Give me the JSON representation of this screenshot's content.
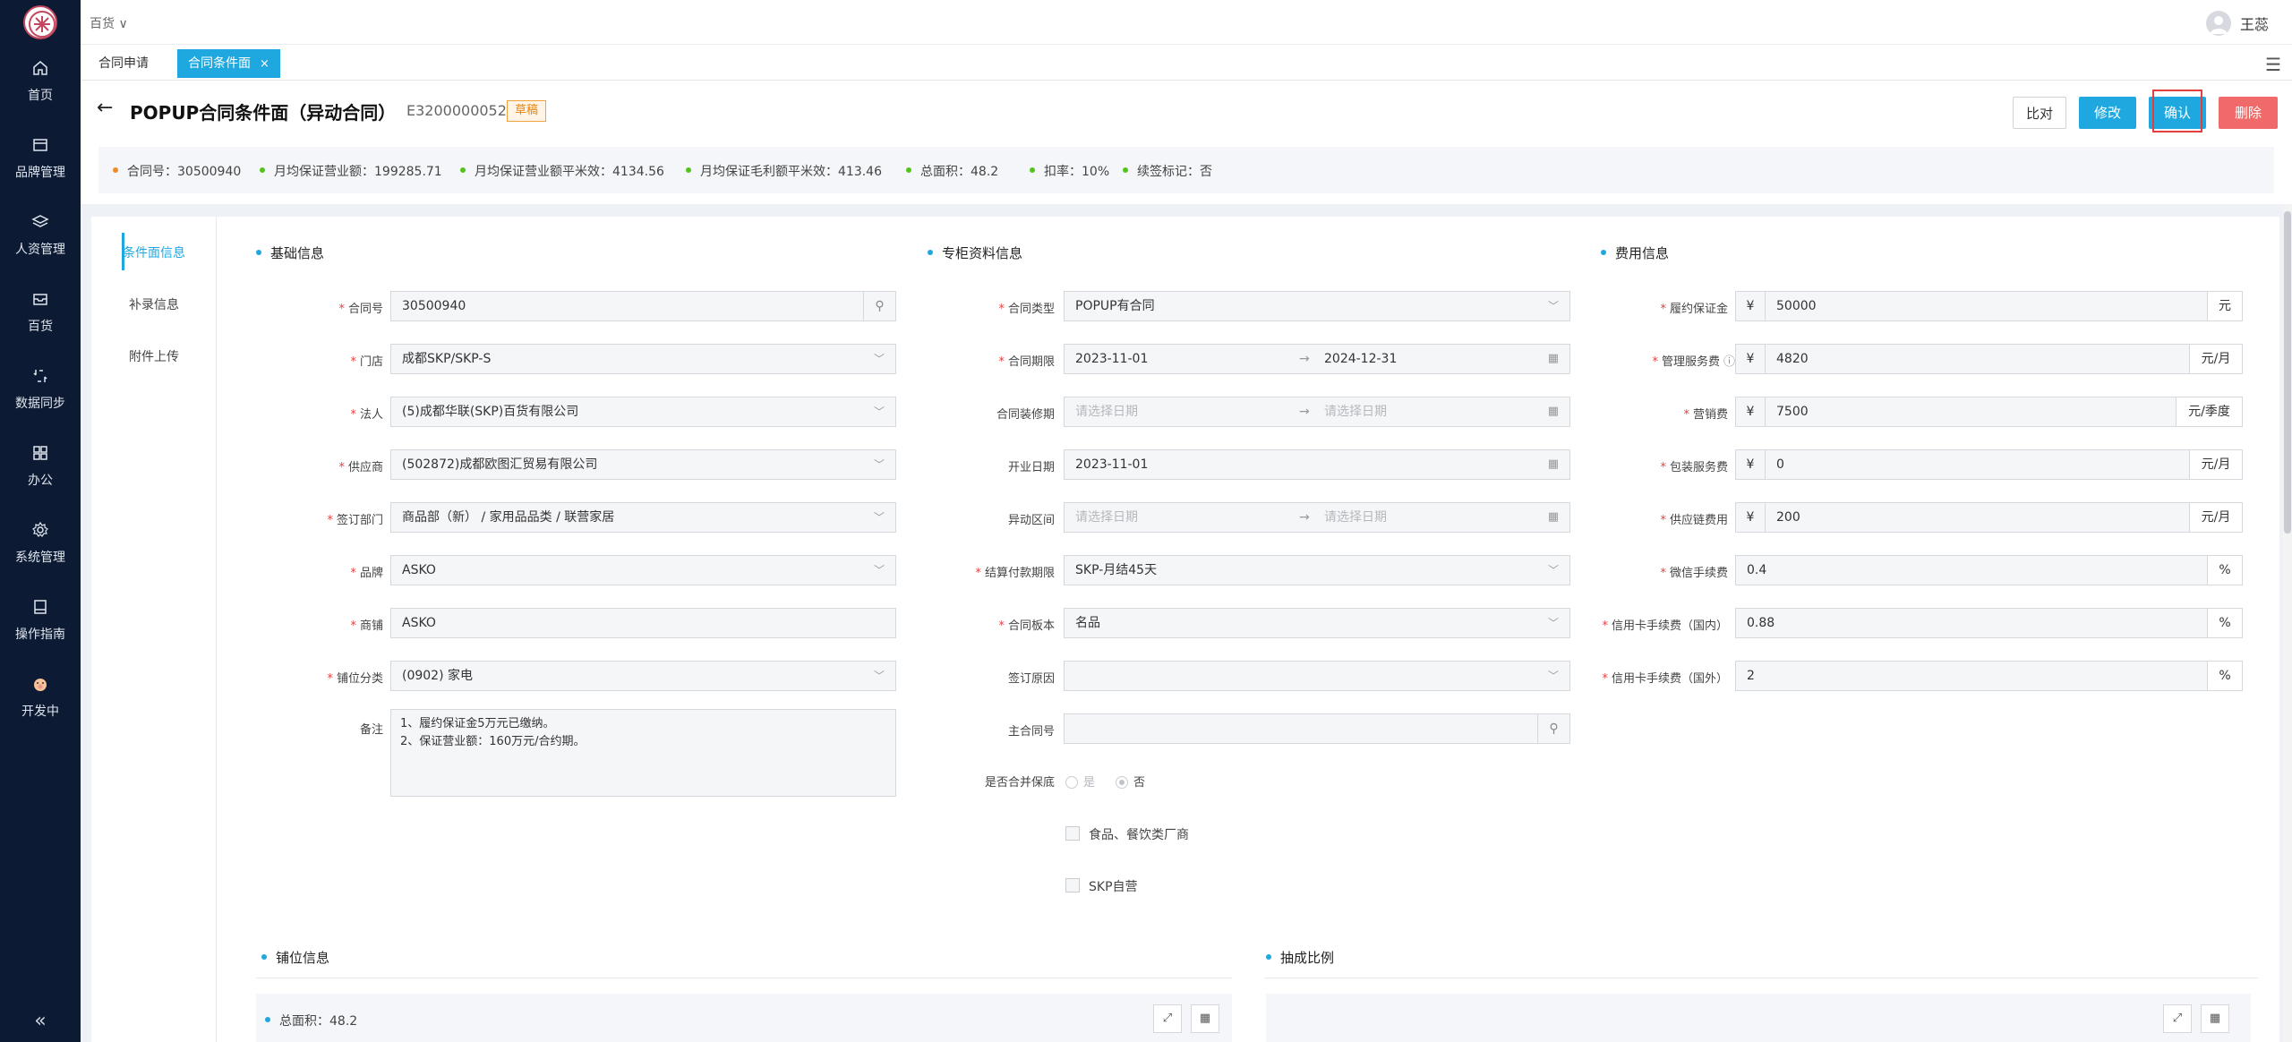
{
  "sidebar": {
    "items": [
      {
        "label": "首页",
        "icon": "home-icon"
      },
      {
        "label": "品牌管理",
        "icon": "brand-icon"
      },
      {
        "label": "人资管理",
        "icon": "layers-icon"
      },
      {
        "label": "百货",
        "icon": "inbox-icon"
      },
      {
        "label": "数据同步",
        "icon": "sync-icon"
      },
      {
        "label": "办公",
        "icon": "grid-icon"
      },
      {
        "label": "系统管理",
        "icon": "gear-icon"
      },
      {
        "label": "操作指南",
        "icon": "book-icon"
      },
      {
        "label": "开发中",
        "icon": "pig-icon"
      }
    ],
    "collapse": "«"
  },
  "topbar": {
    "store": "百货 ∨",
    "user": "王蕊"
  },
  "tabs": [
    {
      "label": "合同申请"
    },
    {
      "label": "合同条件面",
      "close": "×"
    }
  ],
  "header": {
    "back": "←",
    "title": "POPUP合同条件面（异动合同）",
    "code": "E3200000052",
    "status": "草稿",
    "buttons": {
      "compare": "比对",
      "edit": "修改",
      "confirm": "确认",
      "delete": "删除"
    }
  },
  "infobar": [
    {
      "text": "合同号：30500940",
      "color": "#f08a24"
    },
    {
      "text": "月均保证营业额：199285.71",
      "color": "#52c41a"
    },
    {
      "text": "月均保证营业额平米效：4134.56",
      "color": "#52c41a"
    },
    {
      "text": "月均保证毛利额平米效：413.46",
      "color": "#52c41a"
    },
    {
      "text": "总面积：48.2",
      "color": "#52c41a"
    },
    {
      "text": "扣率：10%",
      "color": "#52c41a"
    },
    {
      "text": "续签标记：否",
      "color": "#52c41a"
    }
  ],
  "sidenav": [
    "条件面信息",
    "补录信息",
    "附件上传"
  ],
  "sections": {
    "basic": "基础信息",
    "counter": "专柜资料信息",
    "fee": "费用信息",
    "shop": "铺位信息",
    "ratio": "抽成比例"
  },
  "basic": {
    "contract_no": {
      "label": "合同号",
      "value": "30500940"
    },
    "store": {
      "label": "门店",
      "value": "成都SKP/SKP-S"
    },
    "legal": {
      "label": "法人",
      "value": "(5)成都华联(SKP)百货有限公司"
    },
    "supplier": {
      "label": "供应商",
      "value": "(502872)成都欧图汇贸易有限公司"
    },
    "dept": {
      "label": "签订部门",
      "value": "商品部（新） / 家用品品类 / 联营家居"
    },
    "brand": {
      "label": "品牌",
      "value": "ASKO"
    },
    "shop": {
      "label": "商铺",
      "value": "ASKO"
    },
    "category": {
      "label": "铺位分类",
      "value": "(0902) 家电"
    },
    "remark": {
      "label": "备注",
      "line1": "1、履约保证金5万元已缴纳。",
      "line2": "2、保证营业额：160万元/合约期。"
    }
  },
  "counter": {
    "type": {
      "label": "合同类型",
      "value": "POPUP有合同"
    },
    "period": {
      "label": "合同期限",
      "start": "2023-11-01",
      "arrow": "→",
      "end": "2024-12-31"
    },
    "decor": {
      "label": "合同装修期",
      "start": "请选择日期",
      "arrow": "→",
      "end": "请选择日期"
    },
    "open": {
      "label": "开业日期",
      "value": "2023-11-01"
    },
    "change": {
      "label": "异动区间",
      "start": "请选择日期",
      "arrow": "→",
      "end": "请选择日期"
    },
    "payment": {
      "label": "结算付款期限",
      "value": "SKP-月结45天"
    },
    "template": {
      "label": "合同板本",
      "value": "名品"
    },
    "reason": {
      "label": "签订原因",
      "value": ""
    },
    "main_no": {
      "label": "主合同号",
      "value": ""
    },
    "merge": {
      "label": "是否合并保底",
      "yes": "是",
      "no": "否"
    },
    "food": "食品、餐饮类厂商",
    "skp": "SKP自营"
  },
  "fee": {
    "yen": "¥",
    "deposit": {
      "label": "履约保证金",
      "value": "50000",
      "unit": "元"
    },
    "mgmt": {
      "label": "管理服务费",
      "value": "4820",
      "unit": "元/月",
      "info": "ⓘ"
    },
    "marketing": {
      "label": "营销费",
      "value": "7500",
      "unit": "元/季度"
    },
    "package": {
      "label": "包装服务费",
      "value": "0",
      "unit": "元/月"
    },
    "supply": {
      "label": "供应链费用",
      "value": "200",
      "unit": "元/月"
    },
    "wechat": {
      "label": "微信手续费",
      "value": "0.4",
      "unit": "%"
    },
    "credit_dom": {
      "label": "信用卡手续费（国内）",
      "value": "0.88",
      "unit": "%"
    },
    "credit_int": {
      "label": "信用卡手续费（国外）",
      "value": "2",
      "unit": "%"
    }
  },
  "shopinfo": {
    "area": "总面积：48.2"
  }
}
